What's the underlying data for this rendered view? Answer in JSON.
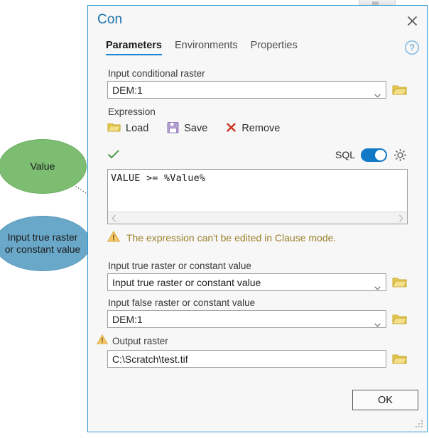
{
  "canvas": {
    "elements": [
      {
        "name": "Value",
        "shape": "ellipse",
        "color": "#7cbd72"
      },
      {
        "name": "Input true raster\nor constant value",
        "label_line1": "Input true raster",
        "label_line2": "or constant value",
        "shape": "ellipse",
        "color": "#6aa8c9"
      }
    ]
  },
  "dialog": {
    "title": "Con",
    "close_label": "×",
    "accent_color": "#2e95d3",
    "tabs": [
      {
        "label": "Parameters",
        "active": true
      },
      {
        "label": "Environments",
        "active": false
      },
      {
        "label": "Properties",
        "active": false
      }
    ],
    "help_icon": "question-circle-icon"
  },
  "fields": {
    "input_conditional_raster": {
      "label": "Input conditional raster",
      "value": "DEM:1",
      "browse_icon": "folder-icon"
    },
    "expression": {
      "label": "Expression",
      "actions": [
        {
          "label": "Load",
          "icon": "open-folder-icon"
        },
        {
          "label": "Save",
          "icon": "floppy-disk-icon"
        },
        {
          "label": "Remove",
          "icon": "red-x-icon"
        }
      ],
      "validate_icon": "green-check-icon",
      "sql_label": "SQL",
      "sql_enabled": true,
      "settings_icon": "gear-icon",
      "text": "VALUE >= %Value%",
      "warning": {
        "icon": "warning-triangle-icon",
        "text": "The expression can't be edited in Clause mode.",
        "color": "#9b8029"
      }
    },
    "input_true_raster": {
      "label": "Input true raster or constant value",
      "value": "Input true raster or constant value",
      "browse_icon": "folder-icon"
    },
    "input_false_raster": {
      "label": "Input false raster or constant value",
      "value": "DEM:1",
      "browse_icon": "folder-icon"
    },
    "output_raster": {
      "label": "Output raster",
      "value": "C:\\Scratch\\test.tif",
      "warning_icon": "warning-triangle-icon",
      "browse_icon": "folder-icon"
    }
  },
  "footer": {
    "ok_label": "OK"
  }
}
